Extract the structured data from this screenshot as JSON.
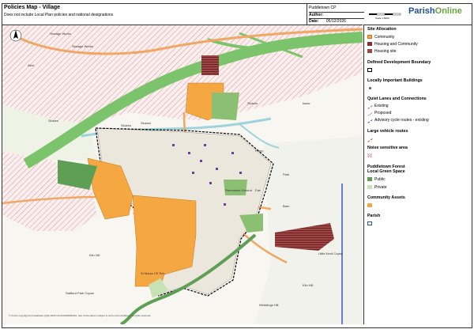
{
  "header": {
    "title": "Policies Map - Village",
    "subtitle": "Does not include Local Plan policies and national designations",
    "parish": "Puddletown CP",
    "author_label": "Author:",
    "author_value": "",
    "date_label": "Date:",
    "date_value": "05/12/2026",
    "scale_label": "Scale 1:5000",
    "logo_a": "Parish",
    "logo_b": "Online"
  },
  "map": {
    "labels": [
      {
        "text": "Sewage Works"
      },
      {
        "text": "Sewage Works"
      },
      {
        "text": "Allot"
      },
      {
        "text": "Sluices"
      },
      {
        "text": "Sluices"
      },
      {
        "text": "Sluices"
      },
      {
        "text": "Sluices"
      },
      {
        "text": "Recreation Ground"
      },
      {
        "text": "Pump"
      },
      {
        "text": "Kiln Hill"
      },
      {
        "text": "Stafford Park Copse"
      },
      {
        "text": "St Marys CE Sch"
      },
      {
        "text": "Weddings Hill"
      },
      {
        "text": "Kiln Hill"
      },
      {
        "text": "Little Kecil Copse"
      },
      {
        "text": "Barn"
      },
      {
        "text": "Park"
      },
      {
        "text": "Fair"
      },
      {
        "text": "Issue"
      }
    ],
    "north_arrow": "N",
    "copyright": "© Crown copyright and database rights 2026 OS AC0000849444. Use of this data is subject to terms and conditions. All rights reserved."
  },
  "legend": {
    "site_allocation": "Site Allocation",
    "community": "Community",
    "housing_and_community": "Housing and Community",
    "housing_site": "Housing site",
    "ddb": "Defined Development Boundary",
    "lib": "Locally Important Buildings",
    "quiet_lanes": "Quiet Lanes and Connections",
    "existing": "Existing",
    "proposed": "Proposed",
    "advisory": "Advisory cycle routes - existing",
    "large_vehicle": "Large vehicle routes",
    "noise": "Noise sensitive area",
    "forest": "Puddletown Forest",
    "lgs": "Local Green Space",
    "public": "Public",
    "private": "Private",
    "community_assets": "Community Assets",
    "parish": "Parish"
  },
  "colors": {
    "community": "#f5a742",
    "housing": "#8b2a2a",
    "road_major": "#7cc46b",
    "road_a": "#f2a663",
    "water": "#9fd3dc",
    "green_public": "#5f9e55",
    "green_private": "#c8e3b3",
    "parish": "#2a4fb0"
  }
}
